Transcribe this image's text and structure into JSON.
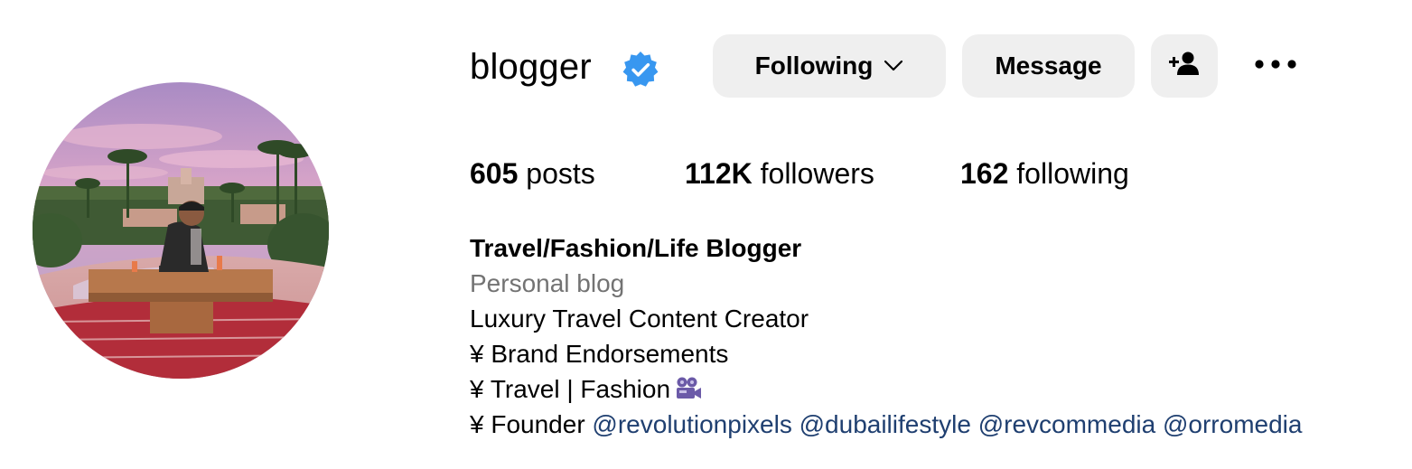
{
  "profile": {
    "username": "blogger",
    "verified": true,
    "avatar_icon": "profile-photo-rooftop-palms"
  },
  "actions": {
    "following_label": "Following",
    "message_label": "Message",
    "add_user_icon": "add-user-icon",
    "more_icon": "more-options-icon"
  },
  "stats": {
    "posts_count": "605",
    "posts_label": "posts",
    "followers_count": "112K",
    "followers_label": "followers",
    "following_count": "162",
    "following_label": "following"
  },
  "bio": {
    "title": "Travel/Fashion/Life Blogger",
    "category": "Personal blog",
    "lines": [
      "Luxury Travel Content Creator",
      "¥ Brand Endorsements",
      "¥ Travel | Fashion"
    ],
    "founder_prefix": "¥ Founder",
    "mentions": [
      "@revolutionpixels",
      "@dubailifestyle",
      "@revcommedia",
      "@orromedia"
    ]
  },
  "colors": {
    "verified_blue": "#3897f0",
    "button_bg": "#efefef",
    "category_gray": "#737373",
    "mention_blue": "#1f3f70"
  }
}
